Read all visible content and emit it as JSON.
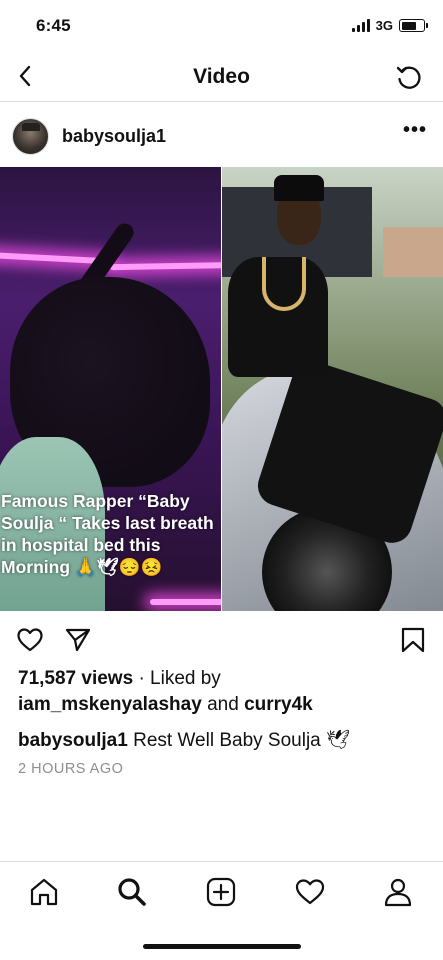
{
  "status_bar": {
    "time": "6:45",
    "network": "3G",
    "icons": [
      "signal-icon",
      "battery-icon"
    ]
  },
  "nav": {
    "title": "Video",
    "back_icon": "chevron-left-icon",
    "refresh_icon": "refresh-icon"
  },
  "post": {
    "username": "babysoulja1",
    "more_icon": "more-icon",
    "overlay_caption": "Famous Rapper “Baby Soulja “ Takes last breath in hospital bed this Morning 🙏🕊😔😣",
    "views_count": "71,587 views",
    "liked_by_prefix": "· Liked by",
    "liked_user_1": "iam_mskenyalashay",
    "liked_and": "and",
    "liked_user_2": "curry4k",
    "caption_user": "babysoulja1",
    "caption_text": "Rest Well Baby Soulja 🕊",
    "time_ago": "2 HOURS AGO",
    "action_icons": [
      "heart-icon",
      "share-icon",
      "bookmark-icon"
    ]
  },
  "tabbar": {
    "icons": [
      "home-icon",
      "search-icon",
      "add-icon",
      "activity-heart-icon",
      "profile-icon"
    ]
  },
  "colors": {
    "text": "#111111",
    "muted": "#8e8e8e",
    "divider": "#dbdbdb",
    "neon": "#ff9cf7"
  }
}
